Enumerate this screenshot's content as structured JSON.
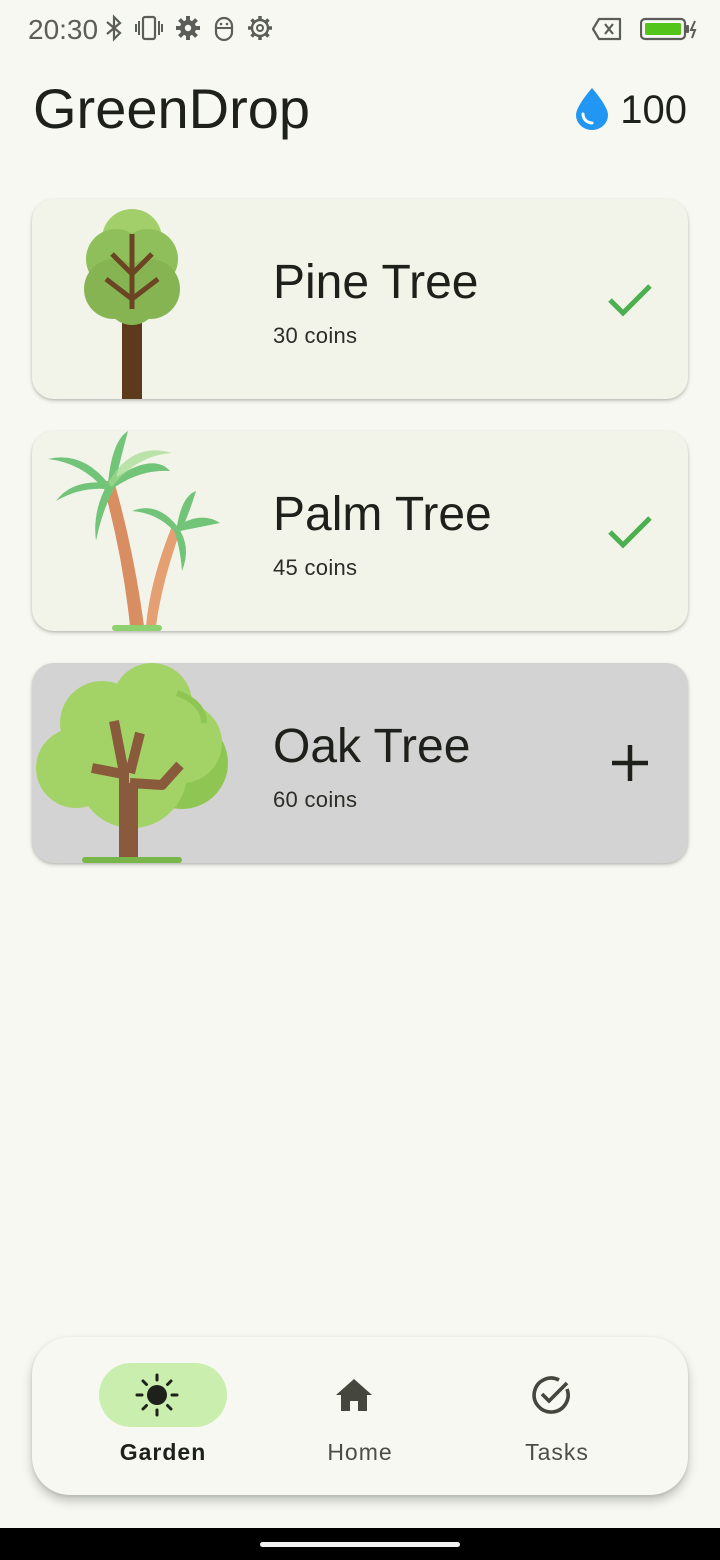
{
  "status_bar": {
    "time": "20:30",
    "left_icons": [
      "bluetooth-icon",
      "vibrate-icon",
      "gear-icon",
      "android-debug-icon",
      "gear-outline-icon"
    ],
    "right_icons": [
      "no-sim-icon",
      "battery-charging-icon"
    ]
  },
  "header": {
    "title": "GreenDrop",
    "coin_icon": "water-drop-icon",
    "coin_count": "100"
  },
  "trees": [
    {
      "name": "Pine Tree",
      "price": "30 coins",
      "state": "owned",
      "action_icon": "checkmark-icon"
    },
    {
      "name": "Palm Tree",
      "price": "45 coins",
      "state": "owned",
      "action_icon": "checkmark-icon"
    },
    {
      "name": "Oak Tree",
      "price": "60 coins",
      "state": "locked",
      "action_icon": "plus-icon"
    }
  ],
  "nav": {
    "items": [
      {
        "label": "Garden",
        "icon": "sun-icon",
        "active": true
      },
      {
        "label": "Home",
        "icon": "home-icon",
        "active": false
      },
      {
        "label": "Tasks",
        "icon": "check-circle-icon",
        "active": false
      }
    ]
  },
  "colors": {
    "background": "#f7f8f1",
    "card": "#f3f4e9",
    "card_locked": "#d4d3d3",
    "check": "#4caf50",
    "drop": "#2196f3",
    "nav_active_pill": "#c9eeae"
  }
}
